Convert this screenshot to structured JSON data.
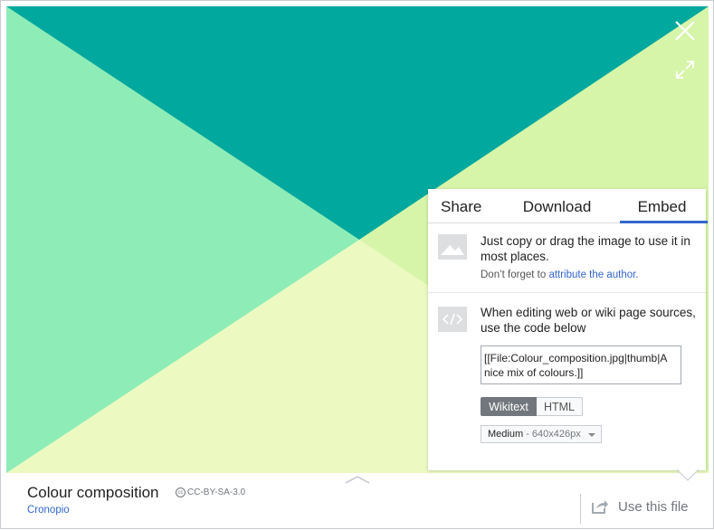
{
  "viewer": {
    "colors": {
      "dark_teal": "#00a89d",
      "mint": "#8eedb7",
      "light_lime": "#d7f5a9",
      "pale_yellow": "#ecfac2"
    }
  },
  "controls": {
    "close_icon": "close-icon",
    "fullscreen_icon": "fullscreen-icon"
  },
  "panel": {
    "tabs": [
      {
        "label": "Share"
      },
      {
        "label": "Download"
      },
      {
        "label": "Embed",
        "active": true
      }
    ],
    "copy_section": {
      "text": "Just copy or drag the image to use it in most places.",
      "attribution_prefix": "Don’t forget to",
      "attribution_link": "attribute the author."
    },
    "embed_section": {
      "text": "When editing web or wiki page sources, use the code below",
      "code": "[[File:Colour_composition.jpg|thumb|A nice mix of colours.]]",
      "format_options": [
        "Wikitext",
        "HTML"
      ],
      "selected_format": "Wikitext",
      "size_label": "Medium",
      "size_dims": "- 640x426px"
    }
  },
  "footer": {
    "title": "Colour composition",
    "license": "CC-BY-SA-3.0",
    "author": "Cronopio",
    "use_file_label": "Use this file"
  },
  "accent_color": "#3366cc"
}
